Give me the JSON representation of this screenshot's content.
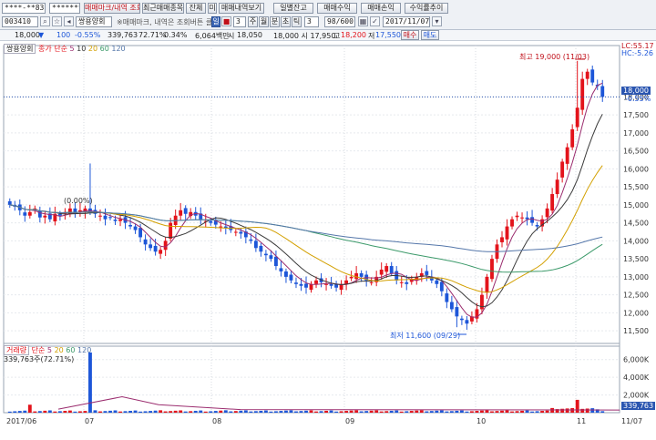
{
  "toolbar": {
    "account_field": "****-**83",
    "password_field": "********",
    "buttons_row1": [
      "매매마크/내역 조회",
      "최근매매종목",
      "잔체",
      "미",
      "매매내역보기",
      "일별잔고",
      "매매수익",
      "매매손익",
      "수익률추이"
    ],
    "stock_code": "003410",
    "stock_name": "쌍용양회",
    "notice": "※매매마크, 내역은 조회버튼 클릭",
    "period_buttons": [
      "일",
      "주",
      "월",
      "분",
      "초",
      "틱"
    ],
    "selected_period": "일",
    "interval_value": "3",
    "count_display": "98/600",
    "date_field": "2017/11/07"
  },
  "quote_bar": {
    "price": "18,000",
    "change": "100",
    "change_pct": "-0.55%",
    "volume": "339,763",
    "vol_ratio": "72.71%",
    "turnover_pct": "0.34%",
    "amount": "6,064백만",
    "open_label": "시",
    "open": "18,050",
    "high_label": "고",
    "high": "18,200",
    "low_label": "저",
    "low": "17,550",
    "close_misc": "18,000 시 17,950",
    "buy_btn": "매수",
    "sell_btn": "매도"
  },
  "legend_price": {
    "name": "쌍용양회",
    "mode": "종가 단순",
    "periods": [
      "5",
      "10",
      "20",
      "60",
      "120"
    ]
  },
  "legend_volume": {
    "name": "거래량",
    "mode": "단순",
    "periods": [
      "5",
      "20",
      "60",
      "120"
    ],
    "value": "339,763주(72.71%)"
  },
  "annotations": {
    "high_marker": "최고 19,000 (11/03)",
    "low_marker": "최저 11,600 (09/29)",
    "prev_label": "(0.00%)",
    "lc": "LC:55.17",
    "hc": "HC:-5.26",
    "price_now": "18,000",
    "pct_now": "-0.55%",
    "vol_now": "339,763"
  },
  "colors": {
    "up": "#e3131b",
    "down": "#1d56d8",
    "ma5": "#9b2d6f",
    "ma10": "#3a3a3a",
    "ma20": "#d3a000",
    "ma60": "#3c9a6a",
    "ma120": "#5577aa"
  },
  "chart_data": {
    "type": "candlestick",
    "y_ticks": [
      "18,000",
      "17,500",
      "17,000",
      "16,500",
      "16,000",
      "15,500",
      "15,000",
      "14,500",
      "14,000",
      "13,500",
      "13,000",
      "12,500",
      "12,000",
      "11,500"
    ],
    "vol_ticks": [
      "6,000K",
      "4,000K",
      "2,000K"
    ],
    "x_ticks": [
      "2017/06",
      "07",
      "08",
      "09",
      "10",
      "11",
      "11/07"
    ],
    "ylim": [
      11200,
      19300
    ]
  }
}
